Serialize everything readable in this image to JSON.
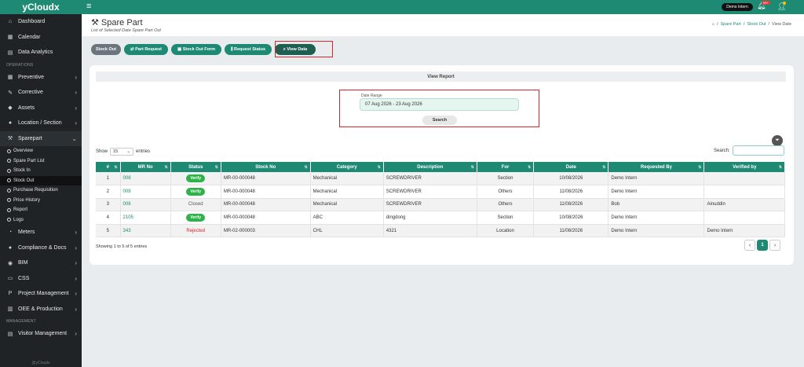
{
  "brand": "yCloudx",
  "sidebar": {
    "top_items": [
      {
        "label": "Dashboard",
        "icon": "home-icon"
      },
      {
        "label": "Calendar",
        "icon": "calendar-icon"
      },
      {
        "label": "Data Analytics",
        "icon": "chart-icon"
      }
    ],
    "operations_label": "OPERATIONS",
    "operations": [
      {
        "label": "Preventive",
        "icon": "calendar-check-icon",
        "chevron": "›"
      },
      {
        "label": "Corrective",
        "icon": "wrench-icon",
        "chevron": "›"
      },
      {
        "label": "Assets",
        "icon": "tag-icon",
        "chevron": "›"
      },
      {
        "label": "Location / Section",
        "icon": "location-icon",
        "chevron": "›"
      },
      {
        "label": "Sparepart",
        "icon": "sparepart-icon",
        "chevron": "⌄"
      }
    ],
    "sparepart_sub": [
      "Overview",
      "Spare Part List",
      "Stock In",
      "Stock Out",
      "Purchase Requisition",
      "Price History",
      "Report",
      "Logs"
    ],
    "more": [
      {
        "label": "Meters",
        "icon": "gauge-icon",
        "chevron": "›"
      },
      {
        "label": "Compliance & Docs",
        "icon": "shield-icon",
        "chevron": "›"
      },
      {
        "label": "BIM",
        "icon": "cube-icon",
        "chevron": "›"
      },
      {
        "label": "CSS",
        "icon": "monitor-icon",
        "chevron": "›"
      },
      {
        "label": "Project Management",
        "icon": "project-icon",
        "chevron": "›"
      },
      {
        "label": "OEE & Production",
        "icon": "factory-icon",
        "chevron": "›"
      }
    ],
    "management_label": "MANAGEMENT",
    "management": [
      {
        "label": "Visitor Management",
        "icon": "id-card-icon",
        "chevron": "›"
      }
    ],
    "footer": "@yCloudx"
  },
  "topbar": {
    "user": "Demo Intern",
    "bell_badge": "99+"
  },
  "header": {
    "title": "Spare Part",
    "subtitle": "List of Selected Date Spare Part Out",
    "breadcrumb": {
      "home": "⌂",
      "link1": "Spare Part",
      "link2": "Stock Out",
      "current": "View Date",
      "sep": "/"
    }
  },
  "buttons": {
    "stock_out": "Stock Out",
    "part_request": "⇄ Part Request",
    "stock_out_form": "▣ Stock Out Form",
    "request_status": "⫼ Request Status",
    "view_data": "⌕ View Data"
  },
  "report": {
    "heading": "View Report",
    "date_label": "Date Range",
    "date_value": "07 Aug 2026 - 23 Aug 2026",
    "search_button": "Search"
  },
  "table_ctrl": {
    "show_label": "Show",
    "show_value": "15",
    "entries_label": "entries",
    "search_label": "Search:"
  },
  "table": {
    "headers": [
      "#",
      "MR No",
      "Status",
      "Stock No",
      "Category",
      "Description",
      "For",
      "Date",
      "Requested By",
      "Verified by"
    ],
    "rows": [
      {
        "num": "1",
        "mr": "008",
        "status": "Verify",
        "stock": "MR-00-000048",
        "category": "Mechanical",
        "desc": "SCREWDRIVER",
        "for": "Section",
        "date": "10/08/2026",
        "req": "Demo Intern",
        "ver": ""
      },
      {
        "num": "2",
        "mr": "008",
        "status": "Verify",
        "stock": "MR-00-000048",
        "category": "Mechanical",
        "desc": "SCREWDRIVER",
        "for": "Others",
        "date": "11/08/2026",
        "req": "Demo Intern",
        "ver": ""
      },
      {
        "num": "3",
        "mr": "008",
        "status": "Closed",
        "stock": "MR-00-000048",
        "category": "Mechanical",
        "desc": "SCREWDRIVER",
        "for": "Others",
        "date": "11/08/2026",
        "req": "Bob",
        "ver": "Ainuddin"
      },
      {
        "num": "4",
        "mr": "2105",
        "status": "Verify",
        "stock": "MR-00-000048",
        "category": "ABC",
        "desc": "dingdong",
        "for": "Section",
        "date": "10/08/2026",
        "req": "Demo Intern",
        "ver": ""
      },
      {
        "num": "5",
        "mr": "343",
        "status": "Rejected",
        "stock": "MR-02-000003",
        "category": "CHL",
        "desc": "4321",
        "for": "Location",
        "date": "11/08/2026",
        "req": "Demo Intern",
        "ver": "Demo Intern"
      }
    ]
  },
  "footer": {
    "info": "Showing 1 to 5 of 5 entries",
    "prev": "‹",
    "page": "1",
    "next": "›"
  }
}
